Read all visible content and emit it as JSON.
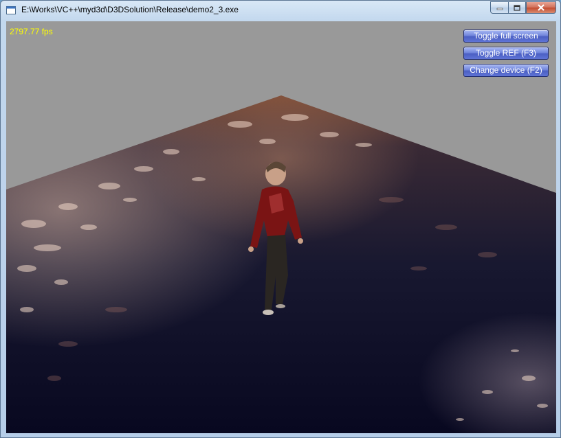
{
  "window": {
    "title": "E:\\Works\\VC++\\myd3d\\D3DSolution\\Release\\demo2_3.exe"
  },
  "hud": {
    "fps": "2797.77 fps"
  },
  "buttons": {
    "toggle_fullscreen": "Toggle full screen",
    "toggle_ref": "Toggle REF (F3)",
    "change_device": "Change device (F2)"
  },
  "colors": {
    "background": "#999999",
    "fps_text": "#ffff00",
    "button_fill": "#5f74d6"
  }
}
